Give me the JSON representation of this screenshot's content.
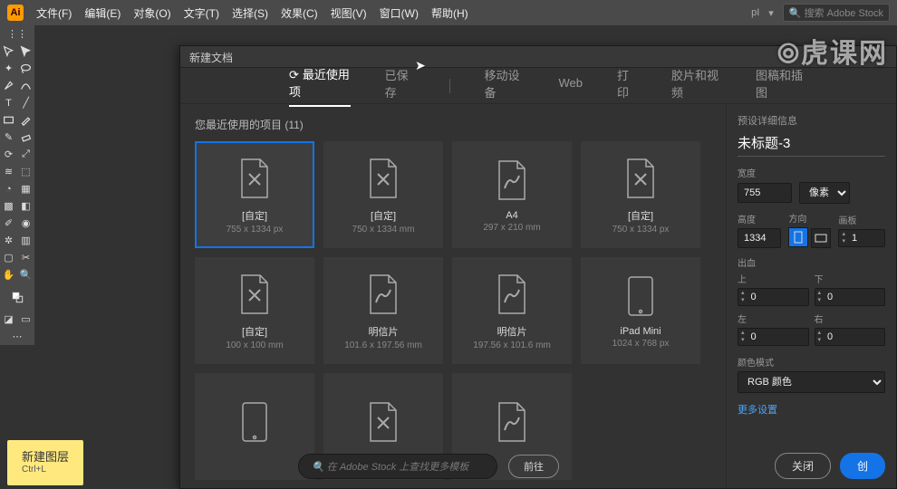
{
  "app": {
    "logo": "Ai"
  },
  "menubar": {
    "items": [
      "文件(F)",
      "编辑(E)",
      "对象(O)",
      "文字(T)",
      "选择(S)",
      "效果(C)",
      "视图(V)",
      "窗口(W)",
      "帮助(H)"
    ],
    "right": {
      "workspace": "pI",
      "search_placeholder": "搜索 Adobe Stock"
    }
  },
  "dialog": {
    "title": "新建文档",
    "tabs": [
      "最近使用项",
      "已保存",
      "移动设备",
      "Web",
      "打印",
      "胶片和视频",
      "图稿和插图"
    ],
    "active_tab": 0,
    "recent_label": "您最近使用的项目 (11)",
    "presets": [
      {
        "name": "[自定]",
        "dim": "755 x 1334 px",
        "icon": "page-ai",
        "selected": true
      },
      {
        "name": "[自定]",
        "dim": "750 x 1334 mm",
        "icon": "page-ai"
      },
      {
        "name": "A4",
        "dim": "297 x 210 mm",
        "icon": "page-draw"
      },
      {
        "name": "[自定]",
        "dim": "750 x 1334 px",
        "icon": "page-ai"
      },
      {
        "name": "[自定]",
        "dim": "100 x 100 mm",
        "icon": "page-ai"
      },
      {
        "name": "明信片",
        "dim": "101.6 x 197.56 mm",
        "icon": "page-draw"
      },
      {
        "name": "明信片",
        "dim": "197.56 x 101.6 mm",
        "icon": "page-draw"
      },
      {
        "name": "iPad Mini",
        "dim": "1024 x 768 px",
        "icon": "device"
      },
      {
        "name": "",
        "dim": "",
        "icon": "device"
      },
      {
        "name": "",
        "dim": "",
        "icon": "page-ai"
      },
      {
        "name": "",
        "dim": "",
        "icon": "page-draw"
      }
    ],
    "stock": {
      "placeholder": "在 Adobe Stock 上查找更多模板",
      "go": "前往"
    },
    "actions": {
      "close": "关闭",
      "create": "创"
    }
  },
  "details": {
    "heading": "预设详细信息",
    "doc_name": "未标题-3",
    "width_label": "宽度",
    "width_value": "755",
    "unit": "像素",
    "height_label": "高度",
    "height_value": "1334",
    "orient_label": "方向",
    "artboard_label": "画板",
    "artboard_count": "1",
    "bleed_label": "出血",
    "bleed": {
      "top_l": "上",
      "top_v": "0",
      "bottom_l": "下",
      "bottom_v": "0",
      "left_l": "左",
      "left_v": "0",
      "right_l": "右",
      "right_v": "0"
    },
    "colormode_label": "颜色模式",
    "colormode_value": "RGB 颜色",
    "more": "更多设置"
  },
  "tooltip": {
    "title": "新建图层",
    "sub": "Ctrl+L"
  },
  "watermark": "⦾虎课网"
}
